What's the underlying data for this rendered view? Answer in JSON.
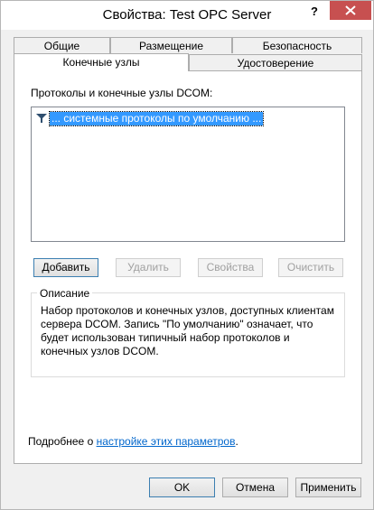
{
  "window": {
    "title": "Свойства: Test OPC Server",
    "help": "?"
  },
  "tabs": {
    "row1": [
      "Общие",
      "Размещение",
      "Безопасность"
    ],
    "row2": [
      "Конечные узлы",
      "Удостоверение"
    ],
    "active": "Конечные узлы"
  },
  "endpoints": {
    "list_label": "Протоколы и конечные узлы DCOM:",
    "items": [
      "... системные протоколы по умолчанию ..."
    ],
    "selected_item": "... системные протоколы по умолчанию ..."
  },
  "buttons": {
    "add": "Добавить",
    "remove": "Удалить",
    "properties": "Свойства",
    "clear": "Очистить",
    "ok": "OK",
    "cancel": "Отмена",
    "apply": "Применить"
  },
  "description": {
    "group_title": "Описание",
    "text": "Набор протоколов и конечных узлов, доступных клиентам сервера DCOM. Запись \"По умолчанию\" означает, что будет использован типичный набор протоколов и конечных узлов DCOM."
  },
  "footer": {
    "prefix": "Подробнее о ",
    "link_text": "настройке этих параметров",
    "suffix": "."
  },
  "colors": {
    "accent": "#3399ff",
    "close_button": "#c75050",
    "link": "#0066cc"
  }
}
